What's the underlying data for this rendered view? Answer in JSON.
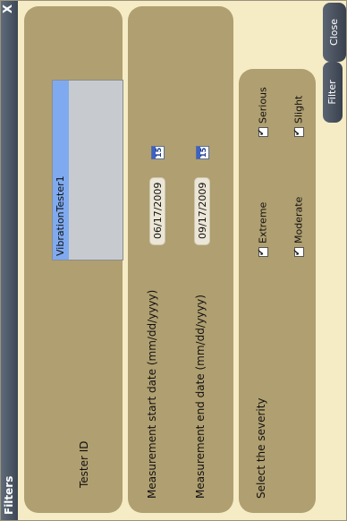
{
  "window": {
    "title": "Filters",
    "close_glyph": "X"
  },
  "tester": {
    "label": "Tester ID",
    "items": [
      "VibrationTester1"
    ]
  },
  "dates": {
    "start_label": "Measurement start date (mm/dd/yyyy)",
    "start_value": "06/17/2009",
    "end_label": "Measurement end date (mm/dd/yyyy)",
    "end_value": "09/17/2009",
    "calendar_icon_text": "15"
  },
  "severity": {
    "label": "Select the severity",
    "options": [
      {
        "label": "Extreme",
        "checked": true
      },
      {
        "label": "Serious",
        "checked": true
      },
      {
        "label": "Moderate",
        "checked": true
      },
      {
        "label": "Slight",
        "checked": true
      }
    ]
  },
  "buttons": {
    "filter": "Filter",
    "close": "Close"
  },
  "colors": {
    "background": "#f5ecc5",
    "panel": "#b09f70",
    "titlebar": "#4a5361",
    "selection": "#7faaf0"
  },
  "icons": {
    "calendar": "calendar-icon",
    "checkbox": "checkbox-checked-icon",
    "close": "close-icon"
  }
}
